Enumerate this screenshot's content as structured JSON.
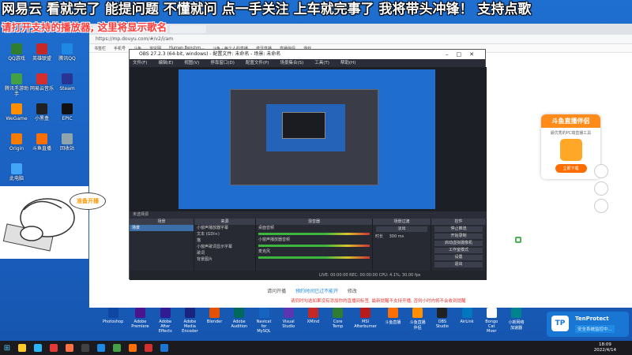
{
  "overlay": {
    "marquee": "网易云 看就完了 能提问题 不懂就问 点一手关注 上车就完事了 我将带头冲锋！ 支持点歌",
    "subnote": "请打开支持的播放器, 这里将显示歌名"
  },
  "desktop_icons": [
    {
      "label": "QQ游戏",
      "color": "#2e7d32"
    },
    {
      "label": "英雄联盟",
      "color": "#c62828"
    },
    {
      "label": "腾讯QQ",
      "color": "#1e88e5"
    },
    {
      "label": "腾讯手游助手",
      "color": "#43a047"
    },
    {
      "label": "网易云音乐",
      "color": "#d32f2f"
    },
    {
      "label": "Steam",
      "color": "#283593"
    },
    {
      "label": "WeGame",
      "color": "#ff8f00"
    },
    {
      "label": "小黑盒",
      "color": "#212121"
    },
    {
      "label": "EPIC",
      "color": "#111111"
    },
    {
      "label": "Origin",
      "color": "#f57c00"
    },
    {
      "label": "斗鱼直播",
      "color": "#ff6f00"
    },
    {
      "label": "回收站",
      "color": "#90a4ae"
    },
    {
      "label": "此电脑",
      "color": "#42a5f5"
    }
  ],
  "browser": {
    "address": "https://mp.douyu.com/#/v2/i/am",
    "bookmarks": [
      "书签栏",
      "手机号",
      "斗鱼",
      "淘宝网",
      "Human Benchm...",
      "斗鱼 - 每个人的直播",
      "虎牙直播",
      "直播伴侣",
      "游戏"
    ],
    "footer_line1_prefix": "请问开播",
    "footer_line1_link": "预约时间已过不能开",
    "footer_line1_action": "修改",
    "footer_line2": "请同时勾选如果没有添加你的直播间标签, 最新提醒不支持开播, 否则小时内将不会收到提醒"
  },
  "obs": {
    "title": "OBS 27.2.3 (64-bit, windows) - 配置文件: 未命名 - 场景: 未命名",
    "menus": [
      "文件(F)",
      "编辑(E)",
      "视图(V)",
      "停靠窗口(D)",
      "配置文件(P)",
      "场景集合(S)",
      "工具(T)",
      "帮助(H)"
    ],
    "labels_bar": "未选择源",
    "docks": {
      "scenes": {
        "title": "场景",
        "items": [
          "场景"
        ]
      },
      "sources": {
        "title": "来源",
        "items": [
          "小窗声播放器字幕",
          "文本 (GDI+)",
          "猫",
          "小窗声歌词显示字幕",
          "歌词",
          "背景图片"
        ]
      },
      "mixer": {
        "title": "混音器",
        "channels": [
          "桌面音频",
          "小窗声播放器音频",
          "麦克风"
        ]
      },
      "transitions": {
        "title": "场景过渡",
        "type": "淡出",
        "duration_label": "时长",
        "duration": "300 ms"
      },
      "controls": {
        "title": "控件",
        "buttons": [
          "停止推流",
          "开始录制",
          "启动虚拟摄像机",
          "工作室模式",
          "设置",
          "退出"
        ]
      }
    },
    "status": "LIVE: 00:00:00   REC: 00:00:00   CPU: 4.1%, 30.00 fps"
  },
  "promo": {
    "title": "斗鱼直播伴侣",
    "subtitle": "最优秀的PC端直播工具",
    "button": "立即下载"
  },
  "cat_bubble": "准备开播",
  "apps": [
    {
      "label": "Photoshop",
      "color": "#0d47a1"
    },
    {
      "label": "Adobe Premiere",
      "color": "#4a148c"
    },
    {
      "label": "Adobe After Effects",
      "color": "#311b92"
    },
    {
      "label": "Adobe Media Encoder",
      "color": "#1a237e"
    },
    {
      "label": "Blender",
      "color": "#e65100"
    },
    {
      "label": "Adobe Audition",
      "color": "#00695c"
    },
    {
      "label": "Navicat for MySQL",
      "color": "#1565c0"
    },
    {
      "label": "Visual Studio",
      "color": "#5e35b1"
    },
    {
      "label": "XMind",
      "color": "#c62828"
    },
    {
      "label": "Core Temp",
      "color": "#2e7d32"
    },
    {
      "label": "MSI Afterburner",
      "color": "#b71c1c"
    },
    {
      "label": "斗鱼直播",
      "color": "#ff6f00"
    },
    {
      "label": "斗鱼直播伴侣",
      "color": "#ff8f00"
    },
    {
      "label": "OBS Studio",
      "color": "#212121"
    },
    {
      "label": "AirLink",
      "color": "#0277bd"
    },
    {
      "label": "Bongo Cat Mver",
      "color": "#fafafa"
    },
    {
      "label": "小新网络加速器",
      "color": "#00838f"
    }
  ],
  "tenprotect": {
    "logo": "TP",
    "title": "TenProtect",
    "message": "安全系统监控中..."
  },
  "taskbar": {
    "time": "18:09",
    "date": "2022/4/14",
    "icons": [
      {
        "name": "explorer",
        "color": "#ffca28"
      },
      {
        "name": "edge",
        "color": "#29b6f6"
      },
      {
        "name": "chrome",
        "color": "#e53935"
      },
      {
        "name": "game",
        "color": "#ff7043"
      },
      {
        "name": "obs",
        "color": "#424242"
      },
      {
        "name": "qq",
        "color": "#1e88e5"
      },
      {
        "name": "wechat",
        "color": "#43a047"
      },
      {
        "name": "douyu",
        "color": "#ff6f00"
      },
      {
        "name": "netease",
        "color": "#d32f2f"
      },
      {
        "name": "vscode",
        "color": "#1976d2"
      }
    ]
  }
}
